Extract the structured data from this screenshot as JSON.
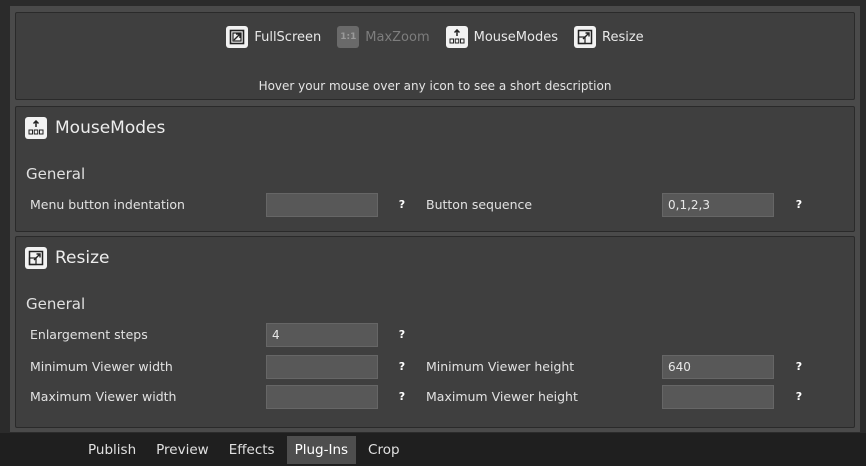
{
  "toolbar": {
    "buttons": [
      {
        "label": "FullScreen",
        "icon": "fullscreen-icon",
        "enabled": true
      },
      {
        "label": "MaxZoom",
        "icon": "maxzoom-icon",
        "icon_text": "1:1",
        "enabled": false
      },
      {
        "label": "MouseModes",
        "icon": "mousemodes-icon",
        "enabled": true
      },
      {
        "label": "Resize",
        "icon": "resize-icon",
        "enabled": true
      }
    ],
    "hint": "Hover your mouse over any icon to see a short description"
  },
  "mousemodes": {
    "title": "MouseModes",
    "subtitle": "General",
    "fields": [
      {
        "label": "Menu button indentation",
        "value": ""
      },
      {
        "label": "Button sequence",
        "value": "0,1,2,3"
      }
    ]
  },
  "resize": {
    "title": "Resize",
    "subtitle": "General",
    "fields": [
      {
        "label": "Enlargement steps",
        "value": "4"
      },
      {
        "label": "Minimum Viewer width",
        "value": ""
      },
      {
        "label": "Minimum Viewer height",
        "value": "640"
      },
      {
        "label": "Maximum Viewer width",
        "value": ""
      },
      {
        "label": "Maximum Viewer height",
        "value": ""
      }
    ]
  },
  "help_symbol": "?",
  "tabs": [
    {
      "label": "Publish",
      "active": false
    },
    {
      "label": "Preview",
      "active": false
    },
    {
      "label": "Effects",
      "active": false
    },
    {
      "label": "Plug-Ins",
      "active": true
    },
    {
      "label": "Crop",
      "active": false
    }
  ],
  "colors": {
    "background": "#2b2b2b",
    "panel": "#3f3f3f",
    "input": "#585858",
    "tabbar": "#1f1f1f",
    "active_tab": "#4e4e4e"
  }
}
